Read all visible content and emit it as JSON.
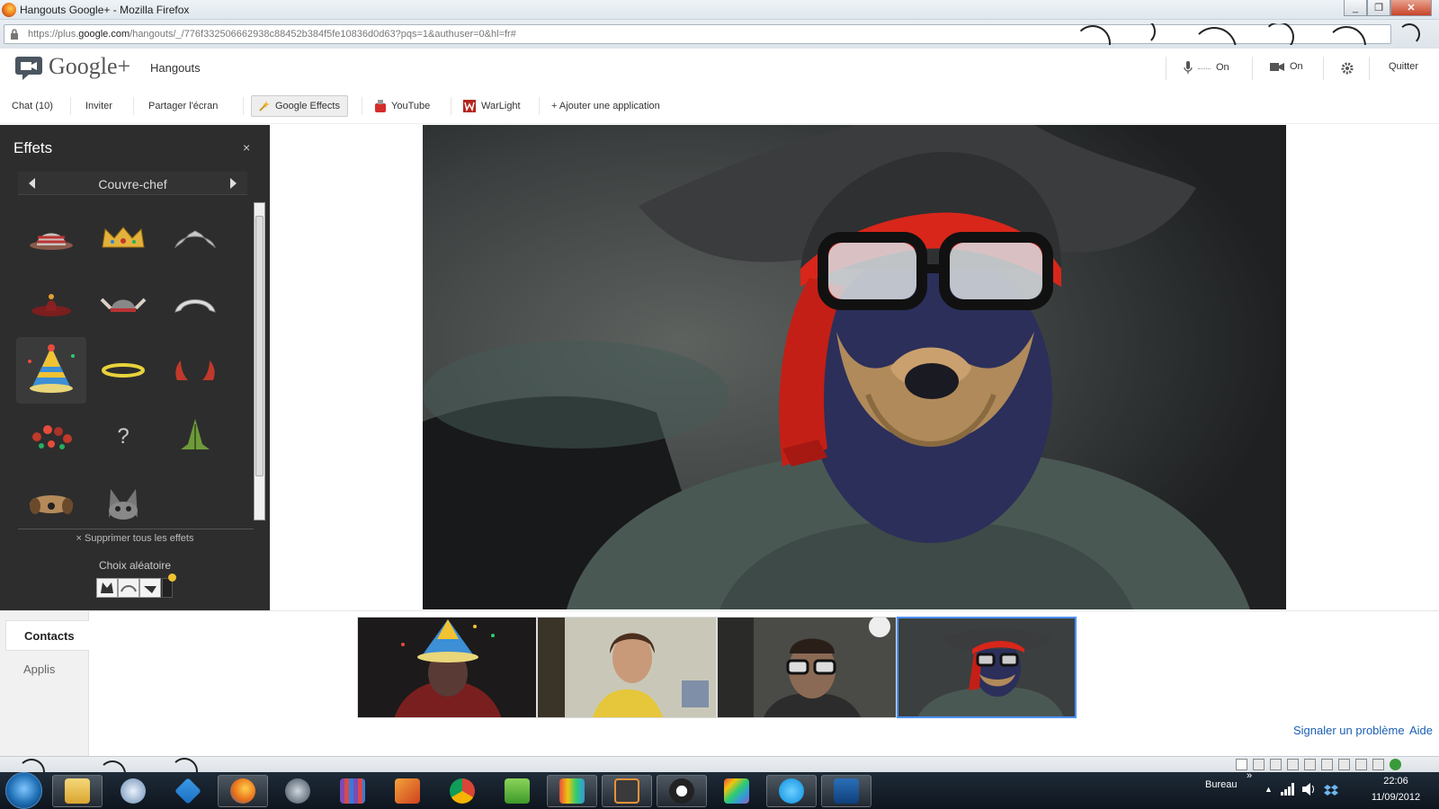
{
  "window": {
    "title": "Hangouts Google+ - Mozilla Firefox"
  },
  "address_bar": {
    "url_prefix": "https://plus.",
    "url_domain": "google.com",
    "url_path": "/hangouts/_/776f332506662938c88452b384f5fe10836d0d63?pqs=1&authuser=0&hl=fr#"
  },
  "header": {
    "logo": "Google+",
    "app_name": "Hangouts",
    "mic_label": "On",
    "cam_label": "On",
    "quit_label": "Quitter"
  },
  "toolbar": {
    "chat": "Chat (10)",
    "invite": "Inviter",
    "share_screen": "Partager l'écran",
    "google_effects": "Google Effects",
    "youtube": "YouTube",
    "warlight": "WarLight",
    "add_app": "+ Ajouter une application"
  },
  "effects": {
    "title": "Effets",
    "close": "×",
    "category": "Couvre-chef",
    "items": [
      "striped-hat",
      "gold-crown",
      "silver-tiara",
      "sombrero",
      "viking-helmet",
      "white-headband",
      "party-hat",
      "halo",
      "devil-horns",
      "flower-crown",
      "question-mark",
      "green-crest",
      "dog-ears",
      "cat-ears"
    ],
    "remove_all": "× Supprimer tous les effets",
    "random_choice": "Choix aléatoire"
  },
  "bottom": {
    "tab_contacts": "Contacts",
    "tab_apps": "Applis",
    "report_link": "Signaler un problème",
    "help_link": "Aide"
  },
  "taskbar": {
    "apps": [
      "windows-explorer",
      "chat-app",
      "dropbox",
      "firefox",
      "steam",
      "library",
      "office",
      "chrome",
      "evernote",
      "movie-studio",
      "sublime-text",
      "github",
      "color-app",
      "skype",
      "powershell"
    ],
    "tray_label": "Bureau",
    "time": "22:06",
    "date": "11/09/2012"
  },
  "colors": {
    "effects_bg": "#2d2d2d",
    "selected_border": "#4d90fe",
    "link": "#1a5fb4",
    "pirate_red": "#d8261b"
  }
}
